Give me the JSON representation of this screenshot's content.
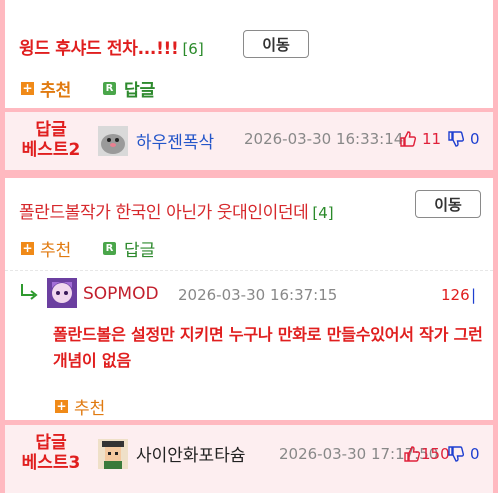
{
  "post1": {
    "title": "윙드 후샤드 전차...!!!",
    "count": "[6]",
    "move_label": "이동"
  },
  "actions1": {
    "recommend": "추천",
    "reply": "답글",
    "reply_badge": "R",
    "plus_glyph": "+"
  },
  "best2": {
    "label_line1": "답글",
    "label_line2": "베스트2",
    "nickname": "하우젠폭삭",
    "date": "2026-03-30 16:33:14",
    "up": "11",
    "down": "0"
  },
  "post2": {
    "title": "폴란드볼작가 한국인 아닌가 웃대인이던데",
    "count": "[4]",
    "move_label": "이동"
  },
  "actions2": {
    "recommend": "추천",
    "reply": "답글",
    "reply_badge": "R",
    "plus_glyph": "+"
  },
  "comment": {
    "nickname": "SOPMOD",
    "date": "2026-03-30 16:37:15",
    "score": "126",
    "text": "폴란드볼은 설정만 지키면 누구나 만화로 만들수있어서 작가 그런 개념이 없음",
    "recommend": "추천",
    "plus_glyph": "+"
  },
  "best3": {
    "label_line1": "답글",
    "label_line2": "베스트3",
    "nickname": "사이안화포타슘",
    "date": "2026-03-30 17:17:50",
    "up": "150",
    "down": "0"
  },
  "colors": {
    "accent_red": "#e01e1e",
    "background_pink": "#ffb9c0",
    "best_row_bg": "#fdeef0",
    "up_red": "#e0203a",
    "down_blue": "#1e3fd0",
    "count_green": "#2a8a2a",
    "recommend_orange": "#f08a18"
  },
  "icons": {
    "recommend": "plus-square-icon",
    "reply": "r-square-icon",
    "thumb_up": "thumb-up-icon",
    "thumb_down": "thumb-down-icon",
    "reply_arrow": "reply-arrow-icon"
  }
}
